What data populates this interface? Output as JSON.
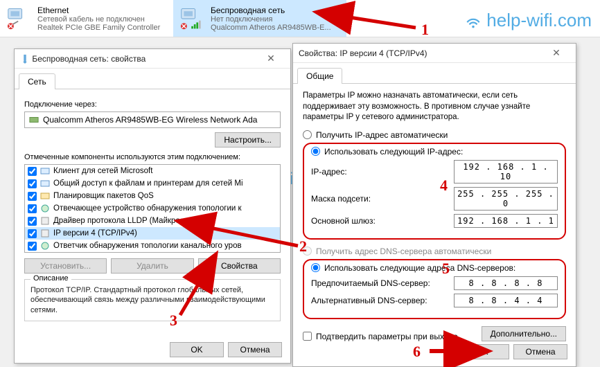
{
  "adapters": [
    {
      "title": "Ethernet",
      "status": "Сетевой кабель не подключен",
      "device": "Realtek PCIe GBE Family Controller"
    },
    {
      "title": "Беспроводная сеть",
      "status": "Нет подключения",
      "device": "Qualcomm Atheros AR9485WB-E..."
    }
  ],
  "watermark": "help-wifi.com",
  "props": {
    "title": "Беспроводная сеть: свойства",
    "tab": "Сеть",
    "connect_label": "Подключение через:",
    "adapter_name": "Qualcomm Atheros AR9485WB-EG Wireless Network Ada",
    "configure_btn": "Настроить...",
    "components_label": "Отмеченные компоненты используются этим подключением:",
    "components": [
      "Клиент для сетей Microsoft",
      "Общий доступ к файлам и принтерам для сетей Mi",
      "Планировщик пакетов QoS",
      "Отвечающее устройство обнаружения топологии к",
      "Драйвер протокола LLDP (Майкрософт)",
      "IP версии 4 (TCP/IPv4)",
      "Ответчик обнаружения топологии канального уров"
    ],
    "sel_index": 5,
    "install_btn": "Установить...",
    "remove_btn": "Удалить",
    "props_btn": "Свойства",
    "desc_legend": "Описание",
    "desc_text": "Протокол TCP/IP. Стандартный протокол глобальных сетей, обеспечивающий связь между различными взаимодействующими сетями.",
    "ok": "OK",
    "cancel": "Отмена"
  },
  "ipv4": {
    "title": "Свойства: IP версии 4 (TCP/IPv4)",
    "tab": "Общие",
    "hint": "Параметры IP можно назначать автоматически, если сеть поддерживает эту возможность. В противном случае узнайте параметры IP у сетевого администратора.",
    "r_auto_ip": "Получить IP-адрес автоматически",
    "r_man_ip": "Использовать следующий IP-адрес:",
    "ip_label": "IP-адрес:",
    "ip_val": "192 . 168 .  1  . 10",
    "mask_label": "Маска подсети:",
    "mask_val": "255 . 255 . 255 .  0",
    "gw_label": "Основной шлюз:",
    "gw_val": "192 . 168 .  1  .  1",
    "r_auto_dns": "Получить адрес DNS-сервера автоматически",
    "r_man_dns": "Использовать следующие адреса DNS-серверов:",
    "dns1_label": "Предпочитаемый DNS-сервер:",
    "dns1_val": "8  .  8  .  8  .  8",
    "dns2_label": "Альтернативный DNS-сервер:",
    "dns2_val": "8  .  8  .  4  .  4",
    "validate": "Подтвердить параметры при выходе",
    "advanced": "Дополнительно...",
    "ok": "OK",
    "cancel": "Отмена"
  },
  "annotations": {
    "n1": "1",
    "n2": "2",
    "n3": "3",
    "n4": "4",
    "n5": "5",
    "n6": "6"
  }
}
